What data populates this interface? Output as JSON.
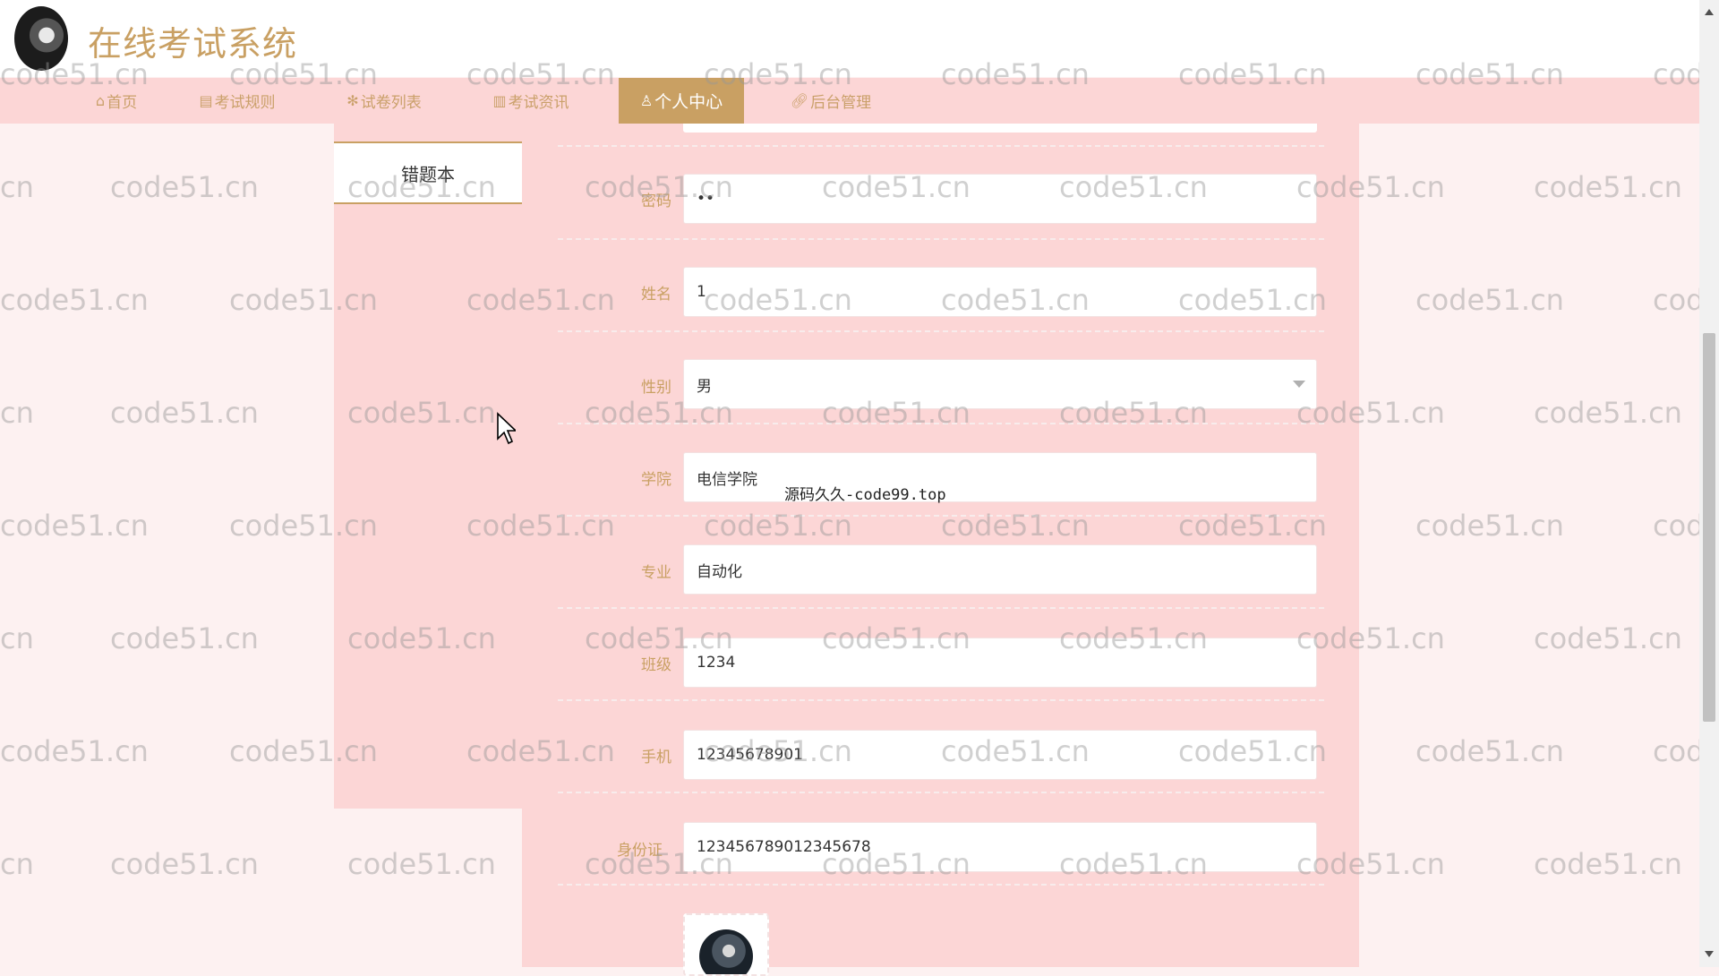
{
  "header": {
    "title": "在线考试系统",
    "logo_icon": "avatar-logo-icon"
  },
  "nav": {
    "items": [
      {
        "label": "首页",
        "icon": "home-icon"
      },
      {
        "label": "考试规则",
        "icon": "document-icon"
      },
      {
        "label": "试卷列表",
        "icon": "gear-icon"
      },
      {
        "label": "考试资讯",
        "icon": "news-icon"
      },
      {
        "label": "个人中心",
        "icon": "user-icon",
        "active": true
      },
      {
        "label": "后台管理",
        "icon": "link-icon"
      }
    ]
  },
  "sidebar": {
    "items": [
      {
        "label": "错题本"
      }
    ]
  },
  "form": {
    "password": {
      "label": "密码",
      "value": "••"
    },
    "name": {
      "label": "姓名",
      "value": "1"
    },
    "gender": {
      "label": "性别",
      "value": "男"
    },
    "college": {
      "label": "学院",
      "value": "电信学院"
    },
    "major": {
      "label": "专业",
      "value": "自动化"
    },
    "class": {
      "label": "班级",
      "value": "1234"
    },
    "phone": {
      "label": "手机",
      "value": "12345678901"
    },
    "id_card": {
      "label": "身份证",
      "value": "123456789012345678"
    }
  },
  "watermark": {
    "text": "code51.cn",
    "text_short_left": "cn",
    "text_short_right": "code",
    "top_left_fragment": "code51.cn",
    "special": "源码久久-code99.top"
  },
  "colors": {
    "accent": "#c9a063",
    "nav_bg": "#fcd6d6",
    "page_bg": "#fdf1f1"
  }
}
